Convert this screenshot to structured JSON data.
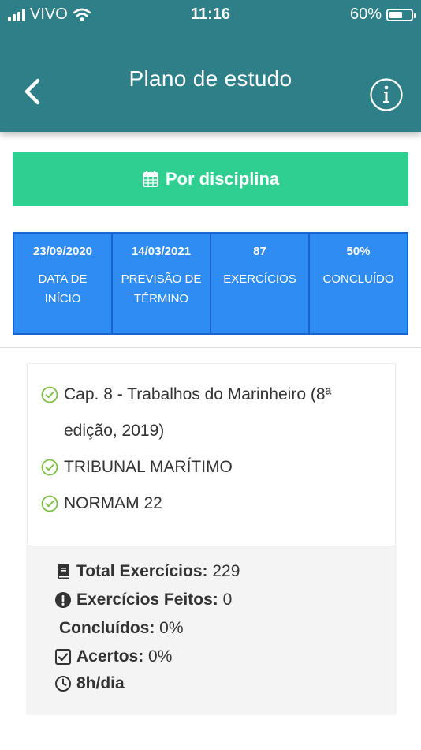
{
  "status_bar": {
    "carrier": "VIVO",
    "time": "11:16",
    "battery": "60%",
    "battery_level": 0.6
  },
  "header": {
    "title": "Plano de estudo",
    "back_icon": "chevron-left-icon",
    "info_icon": "info-circle-icon"
  },
  "discipline_button": {
    "label": "Por disciplina",
    "icon": "calendar-icon"
  },
  "stats": [
    {
      "value": "23/09/2020",
      "label": "DATA DE INÍCIO"
    },
    {
      "value": "14/03/2021",
      "label": "PREVISÃO DE TÉRMINO"
    },
    {
      "value": "87",
      "label": "EXERCÍCIOS"
    },
    {
      "value": "50%",
      "label": "CONCLUÍDO"
    }
  ],
  "topics": [
    "Cap. 8 - Trabalhos do Marinheiro (8ª edição, 2019)",
    "TRIBUNAL MARÍTIMO",
    "NORMAM 22"
  ],
  "summary": {
    "total_label": "Total Exercícios:",
    "total_value": "229",
    "done_label": "Exercícios Feitos:",
    "done_value": "0",
    "completed_label": "Concluídos:",
    "completed_value": "0%",
    "hits_label": "Acertos:",
    "hits_value": "0%",
    "hours": "8h/dia"
  },
  "colors": {
    "header": "#2e7f87",
    "button": "#2fcf91",
    "stat_box": "#2f8cf2",
    "check": "#7bc043"
  }
}
